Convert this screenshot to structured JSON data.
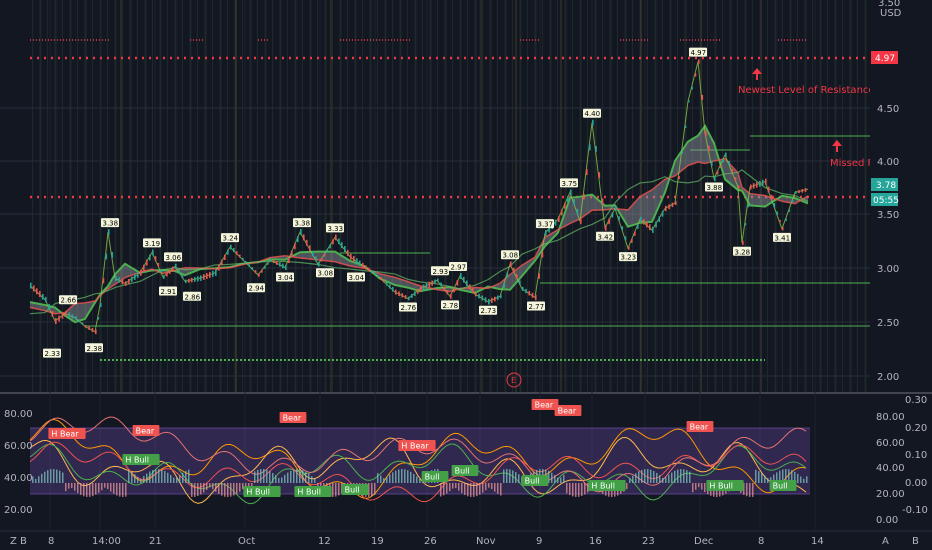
{
  "colors": {
    "background": "#131722",
    "grid": "#2a2e39",
    "resistance": "#f23645",
    "support": "#26a69a",
    "green": "#4caf50",
    "osc_band": "#7e57c2",
    "bear_badge": "#ef5350",
    "bull_badge": "#43a047"
  },
  "price_axis": {
    "unit_top": "3.50",
    "unit_label": "USD",
    "ticks": [
      "4.50",
      "4.00",
      "3.50",
      "3.00",
      "2.50",
      "2.00"
    ],
    "tag_resistance": "4.97",
    "tag_last": "3.78",
    "tag_countdown": "05:55"
  },
  "osc_axis": {
    "left_ticks": [
      "80.00",
      "60.00",
      "40.00",
      "20.00"
    ],
    "right_a_ticks": [
      "80.00",
      "60.00",
      "40.00",
      "20.00",
      "0.00"
    ],
    "right_b_ticks": [
      "0.30",
      "0.20",
      "0.10",
      "0.00",
      "-0.10"
    ]
  },
  "time_axis": {
    "labels": [
      "8",
      "14:00",
      "21",
      "Oct",
      "12",
      "19",
      "26",
      "Nov",
      "9",
      "16",
      "23",
      "Dec",
      "8",
      "14"
    ]
  },
  "annotations": {
    "newest_resistance": "Newest Level of Resistance",
    "missed_pivot": "Missed Piv",
    "earnings_marker": "E"
  },
  "pivot_labels": [
    {
      "text": "2.33",
      "x": 2.33
    },
    {
      "text": "2.66",
      "x": 2.66
    },
    {
      "text": "2.38",
      "x": 2.38
    },
    {
      "text": "3.38",
      "x": 3.38
    },
    {
      "text": "3.19",
      "x": 3.19
    },
    {
      "text": "3.06",
      "x": 3.06
    },
    {
      "text": "2.91",
      "x": 2.91
    },
    {
      "text": "2.86",
      "x": 2.86
    },
    {
      "text": "3.24",
      "x": 3.24
    },
    {
      "text": "2.94",
      "x": 2.94
    },
    {
      "text": "3.04",
      "x": 3.04
    },
    {
      "text": "3.38",
      "x": 3.38
    },
    {
      "text": "3.33",
      "x": 3.33
    },
    {
      "text": "3.08",
      "x": 3.08
    },
    {
      "text": "3.04",
      "x": 3.04
    },
    {
      "text": "2.93",
      "x": 2.93
    },
    {
      "text": "2.76",
      "x": 2.76
    },
    {
      "text": "2.97",
      "x": 2.97
    },
    {
      "text": "2.78",
      "x": 2.78
    },
    {
      "text": "2.73",
      "x": 2.73
    },
    {
      "text": "3.08",
      "x": 3.08
    },
    {
      "text": "2.77",
      "x": 2.77
    },
    {
      "text": "3.37",
      "x": 3.37
    },
    {
      "text": "3.75",
      "x": 3.75
    },
    {
      "text": "4.40",
      "x": 4.4
    },
    {
      "text": "3.42",
      "x": 3.42
    },
    {
      "text": "3.23",
      "x": 3.23
    },
    {
      "text": "4.97",
      "x": 4.97
    },
    {
      "text": "3.88",
      "x": 3.88
    },
    {
      "text": "3.28",
      "x": 3.28
    },
    {
      "text": "3.41",
      "x": 3.41
    }
  ],
  "osc_badges": [
    {
      "text": "H Bear",
      "type": "bear"
    },
    {
      "text": "Bear",
      "type": "bear"
    },
    {
      "text": "H Bull",
      "type": "bull"
    },
    {
      "text": "Bear",
      "type": "bear"
    },
    {
      "text": "H Bear",
      "type": "bear"
    },
    {
      "text": "Bear",
      "type": "bear"
    },
    {
      "text": "Bear",
      "type": "bear"
    },
    {
      "text": "Bear",
      "type": "bear"
    },
    {
      "text": "H Bull",
      "type": "bull"
    },
    {
      "text": "H Bull",
      "type": "bull"
    },
    {
      "text": "Bull",
      "type": "bull"
    },
    {
      "text": "Bull",
      "type": "bull"
    },
    {
      "text": "H Bull",
      "type": "bull"
    },
    {
      "text": "Bull",
      "type": "bull"
    },
    {
      "text": "Bull",
      "type": "bull"
    },
    {
      "text": "H Bull",
      "type": "bull"
    },
    {
      "text": "Bull",
      "type": "bull"
    }
  ],
  "footer": {
    "left_a": "Z",
    "left_b": "B",
    "right_a": "A",
    "right_b": "B"
  }
}
